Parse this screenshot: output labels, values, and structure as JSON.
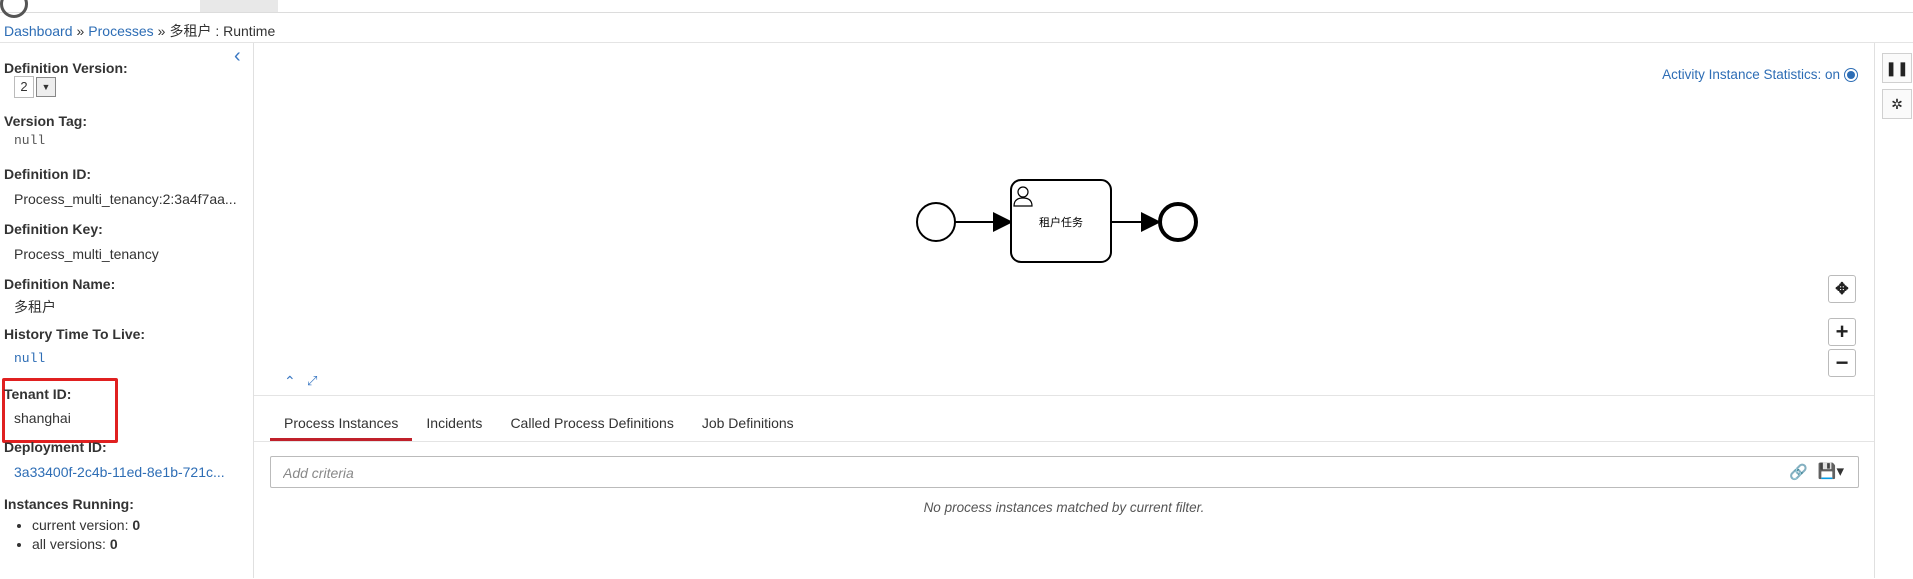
{
  "breadcrumb": {
    "dashboard": "Dashboard",
    "sep1": "»",
    "processes": "Processes",
    "sep2": "»",
    "current": "多租户 : Runtime"
  },
  "sidebar": {
    "collapse_icon": "chevron-left",
    "definition_version_label": "Definition Version:",
    "definition_version_value": "2",
    "version_tag_label": "Version Tag:",
    "version_tag_value": "null",
    "definition_id_label": "Definition ID:",
    "definition_id_value": "Process_multi_tenancy:2:3a4f7aa...",
    "definition_key_label": "Definition Key:",
    "definition_key_value": "Process_multi_tenancy",
    "definition_name_label": "Definition Name:",
    "definition_name_value": "多租户",
    "history_ttl_label": "History Time To Live:",
    "history_ttl_value": "null",
    "tenant_id_label": "Tenant ID:",
    "tenant_id_value": "shanghai",
    "deployment_id_label": "Deployment ID:",
    "deployment_id_value": "3a33400f-2c4b-11ed-8e1b-721c...",
    "instances_running_label": "Instances Running:",
    "current_version_label": "current version:",
    "current_version_value": "0",
    "all_versions_label": "all versions:",
    "all_versions_value": "0"
  },
  "diagram": {
    "stats_label": "Activity Instance Statistics: on",
    "task_label": "租户任务",
    "zoom_in": "+",
    "zoom_out": "−",
    "reset_icon": "move-icon",
    "minimap_icon": "chevron-up",
    "fullscreen_icon": "expand-icon"
  },
  "rail": {
    "pause_icon": "pause-icon",
    "settings_icon": "gear-icon"
  },
  "tabs": [
    {
      "label": "Process Instances",
      "active": true
    },
    {
      "label": "Incidents",
      "active": false
    },
    {
      "label": "Called Process Definitions",
      "active": false
    },
    {
      "label": "Job Definitions",
      "active": false
    }
  ],
  "filter": {
    "placeholder": "Add criteria",
    "no_results": "No process instances matched by current filter."
  },
  "colors": {
    "link": "#2d6db5",
    "active_tab": "#c0202a",
    "highlight_box": "#e02020"
  }
}
